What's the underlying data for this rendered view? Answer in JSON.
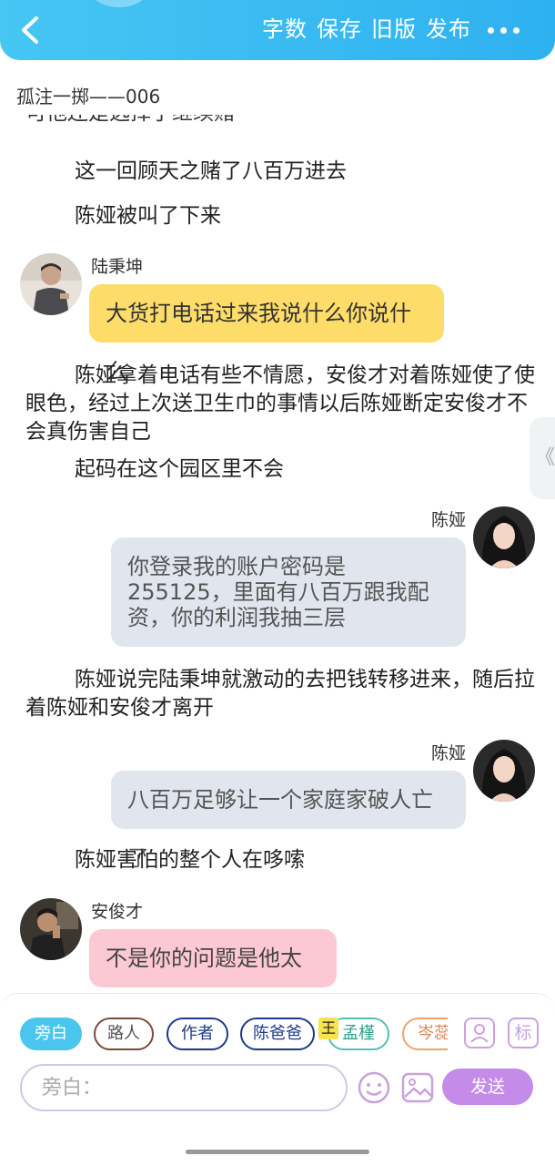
{
  "header": {
    "buttons": [
      "字数",
      "保存",
      "旧版",
      "发布"
    ],
    "icons": {
      "back": "back-chevron-icon",
      "more": "more-dots-icon"
    },
    "colors": {
      "bar": "#2eb1f0",
      "text": "#ffffff"
    }
  },
  "chapter_title": "孤注一掷——006",
  "cut_off_top_text": "可他还是选择了继续赌",
  "messages": {
    "m1": "这一回顾天之赌了八百万进去",
    "m2": "陈娅被叫了下来",
    "m3": {
      "speaker": "陆秉坤",
      "text": "大货打电话过来我说什么你说什么"
    },
    "m4": "陈娅拿着电话有些不情愿，安俊才对着陈娅使了使眼色，经过上次送卫生巾的事情以后陈娅断定安俊才不会真伤害自己",
    "m5": "起码在这个园区里不会",
    "m6": {
      "speaker": "陈娅",
      "text": "你登录我的账户密码是255125，里面有八百万跟我配资，你的利润我抽三层"
    },
    "m7": "陈娅说完陆秉坤就激动的去把钱转移进来，随后拉着陈娅和安俊才离开",
    "m8": {
      "speaker": "陈娅",
      "text": "八百万足够让一个家庭家破人亡了"
    },
    "m9": "陈娅害怕的整个人在哆嗦",
    "m10": {
      "speaker": "安俊才",
      "text": "不是你的问题是他太贪"
    }
  },
  "side_tab": "《",
  "roles": {
    "items": [
      "旁白",
      "路人",
      "作者",
      "陈爸爸",
      "孟槿",
      "岑蕊"
    ],
    "active": "旁白",
    "crown_badge": "王",
    "icons": [
      "person-card-icon"
    ],
    "tag_button": "标"
  },
  "input": {
    "placeholder": "旁白："
  },
  "send_label": "发送",
  "bottom_icons": {
    "emoji": "emoji-icon",
    "image": "image-icon"
  }
}
